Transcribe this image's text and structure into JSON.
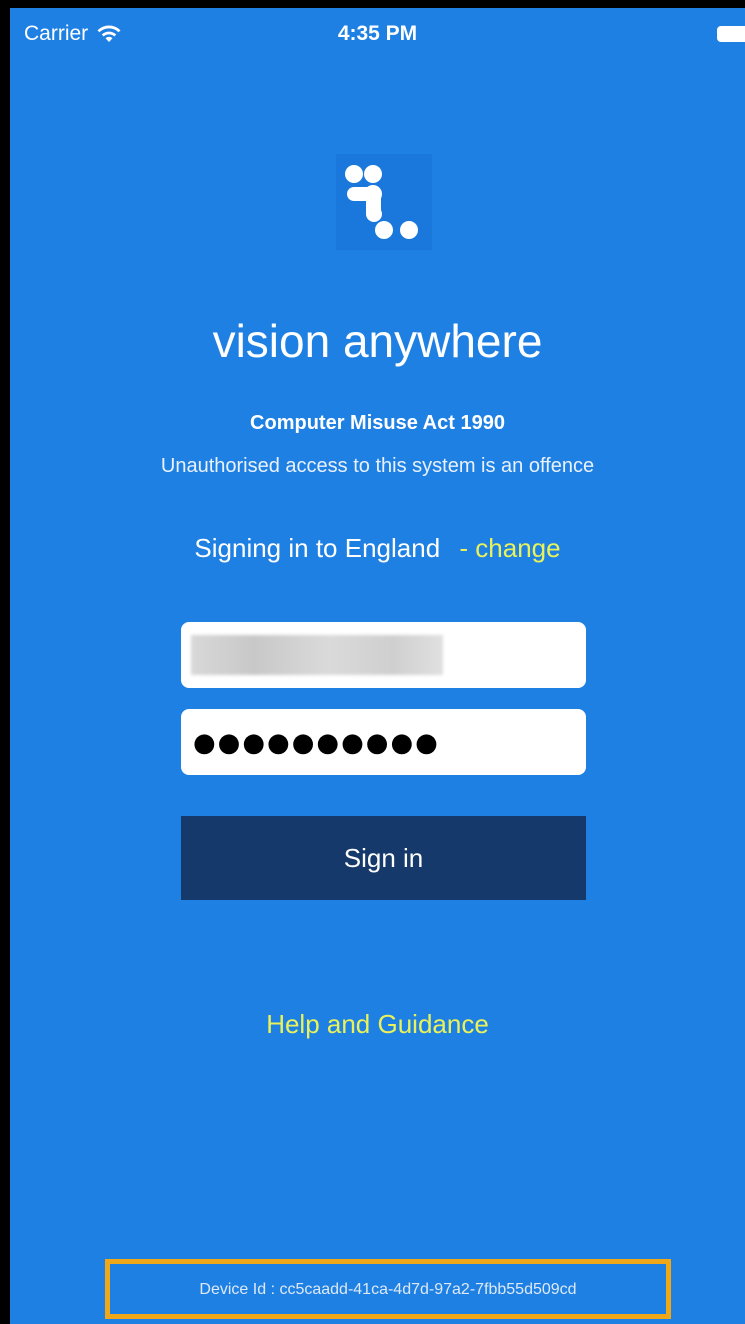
{
  "status_bar": {
    "carrier": "Carrier",
    "time": "4:35 PM",
    "icons": [
      "wifi-icon",
      "battery-icon"
    ]
  },
  "app": {
    "logo_icon": "vision-anywhere-logo",
    "title": "vision anywhere"
  },
  "notice": {
    "heading": "Computer Misuse Act 1990",
    "text": "Unauthorised access to this system is an offence"
  },
  "region": {
    "label": "Signing in to England",
    "change_link": "- change"
  },
  "form": {
    "password_value": "●●●●●●●●●●",
    "signin_label": "Sign in"
  },
  "help": {
    "label": "Help and Guidance"
  },
  "device": {
    "text": "Device Id : cc5caadd-41ca-4d7d-97a2-7fbb55d509cd"
  },
  "colors": {
    "background": "#1f80e3",
    "button": "#15396a",
    "link": "#e9f25a",
    "highlight_border": "#f0a818"
  }
}
